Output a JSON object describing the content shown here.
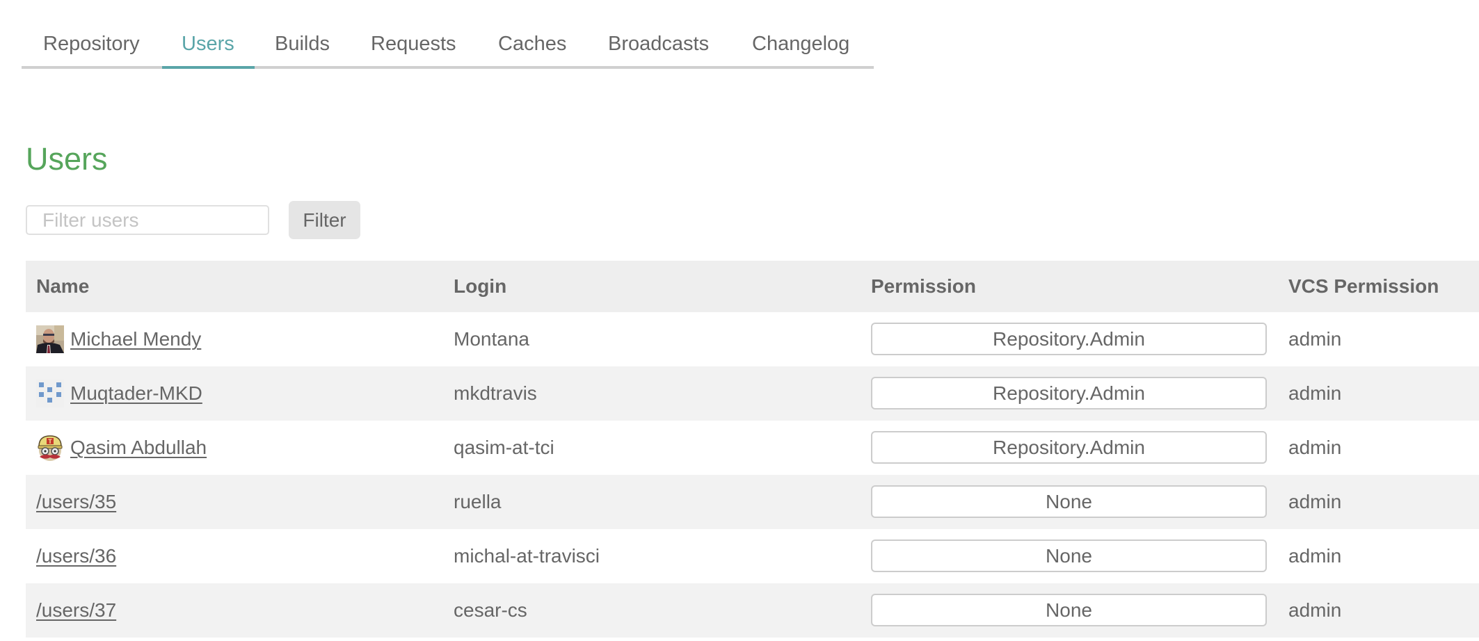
{
  "tabs": [
    {
      "label": "Repository",
      "active": false
    },
    {
      "label": "Users",
      "active": true
    },
    {
      "label": "Builds",
      "active": false
    },
    {
      "label": "Requests",
      "active": false
    },
    {
      "label": "Caches",
      "active": false
    },
    {
      "label": "Broadcasts",
      "active": false
    },
    {
      "label": "Changelog",
      "active": false
    }
  ],
  "page": {
    "title": "Users"
  },
  "filter": {
    "placeholder": "Filter users",
    "value": "",
    "button_label": "Filter"
  },
  "table": {
    "columns": [
      "Name",
      "Login",
      "Permission",
      "VCS Permission"
    ],
    "rows": [
      {
        "name": "Michael Mendy",
        "avatar": "photo-avatar",
        "login": "Montana",
        "permission": "Repository.Admin",
        "vcs_permission": "admin"
      },
      {
        "name": "Muqtader-MKD",
        "avatar": "identicon-avatar",
        "login": "mkdtravis",
        "permission": "Repository.Admin",
        "vcs_permission": "admin"
      },
      {
        "name": "Qasim Abdullah",
        "avatar": "travis-mascot-avatar",
        "login": "qasim-at-tci",
        "permission": "Repository.Admin",
        "vcs_permission": "admin"
      },
      {
        "name": "/users/35",
        "avatar": null,
        "login": "ruella",
        "permission": "None",
        "vcs_permission": "admin"
      },
      {
        "name": "/users/36",
        "avatar": null,
        "login": "michal-at-travisci",
        "permission": "None",
        "vcs_permission": "admin"
      },
      {
        "name": "/users/37",
        "avatar": null,
        "login": "cesar-cs",
        "permission": "None",
        "vcs_permission": "admin"
      }
    ]
  },
  "colors": {
    "accent_tab": "#5aa5a8",
    "title_green": "#56a55b",
    "text": "#666666",
    "header_bg": "#eeeeee",
    "row_alt_bg": "#f2f2f2"
  }
}
